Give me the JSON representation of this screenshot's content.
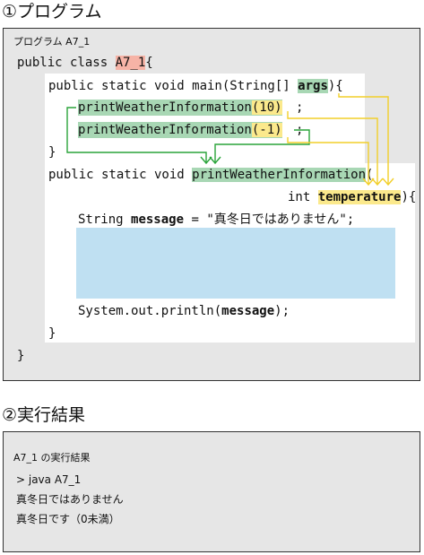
{
  "heading_program": "①プログラム",
  "heading_result": "②実行結果",
  "code": {
    "caption": "プログラム A7_1",
    "line1_pre": "public class ",
    "class_name": "A7_1",
    "line1_post": "{",
    "main_sig": "public static void main(String[] ",
    "args": "args",
    "main_end": "){",
    "call_method": "printWeatherInformation",
    "call1_arg": "(10)",
    "call2_arg": "(-1)",
    "semicolon": ";",
    "close_brace": "}",
    "method_sig": "public static void ",
    "method_name": "printWeatherInformation",
    "open_paren": "(",
    "param_type": "int ",
    "param_name": "temperature",
    "param_end": "){",
    "string_decl": "String ",
    "message": "message",
    "string_value": " = \"真冬日ではありません\";",
    "println_pre": "System.out.println(",
    "println_post": ");"
  },
  "result": {
    "caption": "A7_1 の実行結果",
    "lines": [
      "> java A7_1",
      "真冬日ではありません",
      "真冬日です（0未満）"
    ]
  },
  "colors": {
    "class_highlight": "#f6b3a6",
    "method_highlight": "#a8d7b4",
    "arg_highlight": "#fbe98c",
    "blank_box": "#bfe0f2",
    "arrow_green": "#2aa43a",
    "arrow_yellow": "#f2cf2a"
  }
}
